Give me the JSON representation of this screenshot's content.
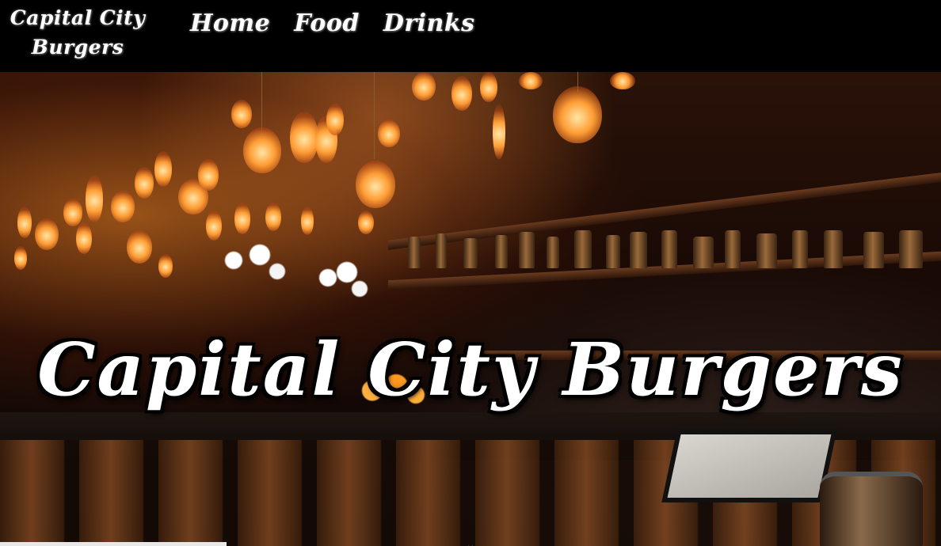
{
  "header": {
    "logo_line1": "Capital City",
    "logo_line2": "Burgers",
    "nav": [
      {
        "label": "Home"
      },
      {
        "label": "Food"
      },
      {
        "label": "Drinks"
      }
    ]
  },
  "hero": {
    "title": "Capital City Burgers",
    "scroll_glyph": "⌄"
  },
  "colors": {
    "header_bg": "#000000",
    "text": "#ffffff",
    "accent_glow": "#ff9d35"
  }
}
